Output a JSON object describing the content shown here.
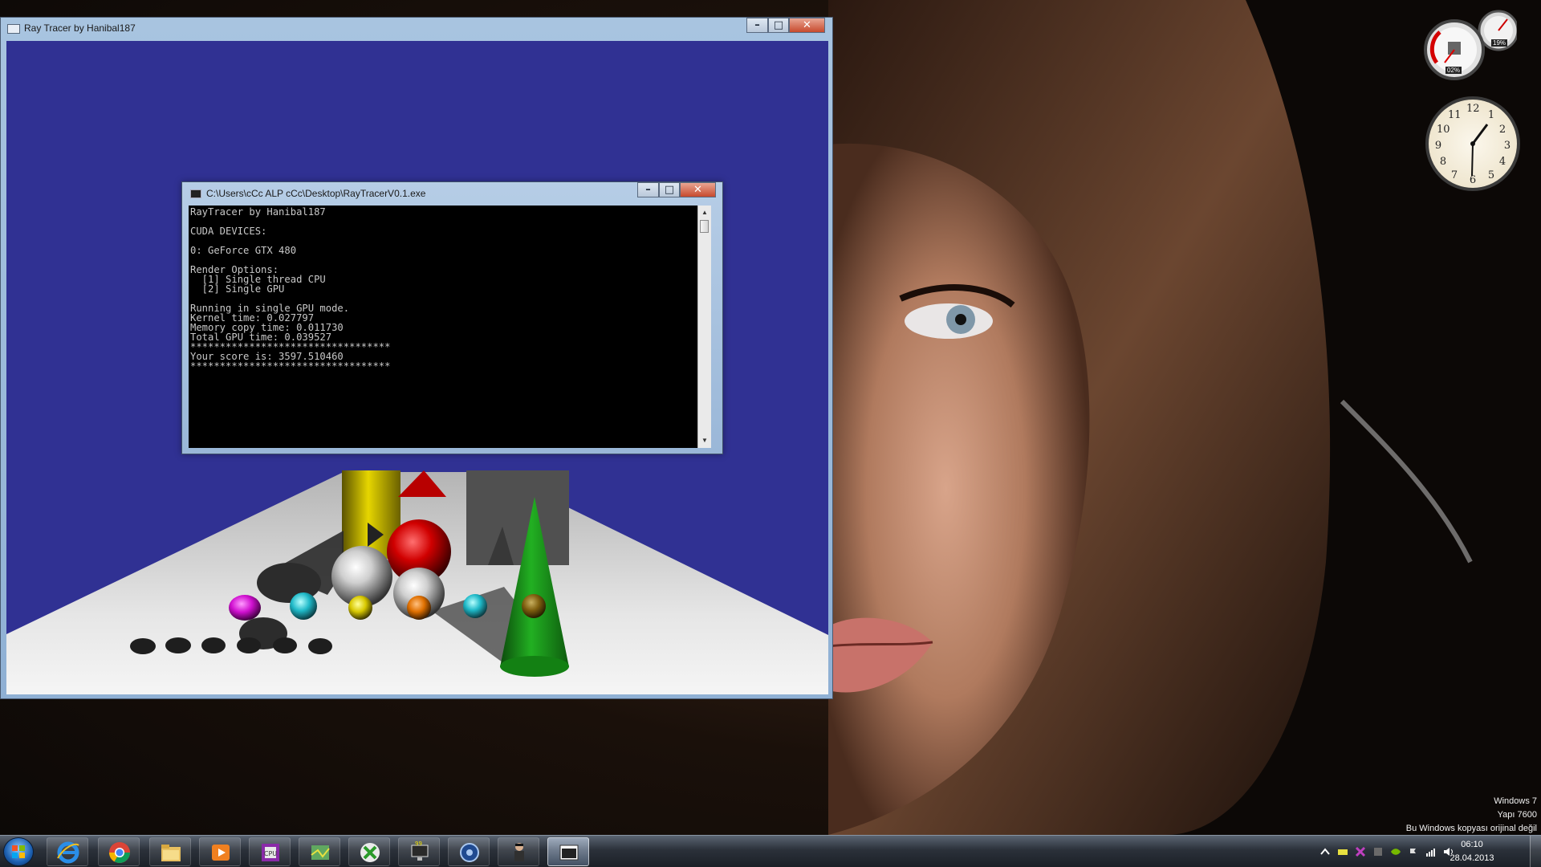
{
  "ray_tracer_window": {
    "title": "Ray Tracer by Hanibal187"
  },
  "console_window": {
    "title": "C:\\Users\\cCc ALP cCc\\Desktop\\RayTracerV0.1.exe",
    "lines": [
      "RayTracer by Hanibal187",
      "",
      "CUDA DEVICES:",
      "",
      "0: GeForce GTX 480",
      "",
      "Render Options:",
      "  [1] Single thread CPU",
      "  [2] Single GPU",
      "",
      "Running in single GPU mode.",
      "Kernel time: 0.027797",
      "Memory copy time: 0.011730",
      "Total GPU time: 0.039527",
      "**********************************",
      "Your score is: 3597.510460",
      "**********************************"
    ]
  },
  "window_buttons": {
    "minimize": "–",
    "maximize": "□",
    "close": "✕"
  },
  "gadgets": {
    "cpu_meter_left": "02%",
    "cpu_meter_right": "19%",
    "clock_numbers": [
      "12",
      "1",
      "2",
      "3",
      "4",
      "5",
      "6",
      "7",
      "8",
      "9",
      "10",
      "11"
    ]
  },
  "watermark": {
    "line1": "Windows 7",
    "line2": "Yapı 7600",
    "line3": "Bu Windows kopyası orijinal değil"
  },
  "taskbar": {
    "apps": [
      {
        "icon": "internet-explorer-icon"
      },
      {
        "icon": "chrome-icon"
      },
      {
        "icon": "file-explorer-icon"
      },
      {
        "icon": "media-player-icon"
      },
      {
        "icon": "cpu-z-icon"
      },
      {
        "icon": "map-app-icon"
      },
      {
        "icon": "xbox-icon"
      },
      {
        "icon": "computer-monitor-icon"
      },
      {
        "icon": "tools-app-icon"
      },
      {
        "icon": "game-character-icon"
      },
      {
        "icon": "console-app-icon"
      }
    ],
    "clock_time": "06:10",
    "clock_date": "28.04.2013"
  },
  "colors": {
    "render_background": "#303193",
    "floor": "#f0f0f0",
    "sphere_red": "#d00000",
    "cone_green": "#1a9a1a",
    "cylinder_yellow": "#e0d000"
  }
}
